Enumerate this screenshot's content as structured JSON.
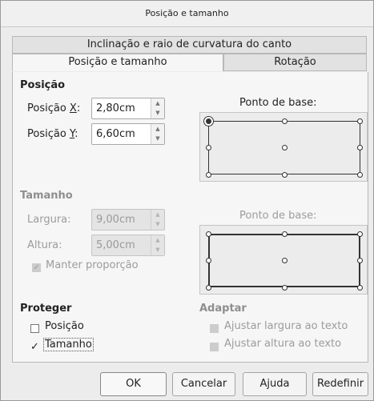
{
  "window": {
    "title": "Posição e tamanho"
  },
  "tabs": {
    "row1": {
      "slant": "Inclinação e raio de curvatura do canto"
    },
    "row2": {
      "position_size": "Posição e tamanho",
      "rotation": "Rotação"
    }
  },
  "position": {
    "header": "Posição",
    "x_label": "Posição X:",
    "x_mnemonic": "X",
    "x_value": "2,80cm",
    "y_label": "Posição Y:",
    "y_mnemonic": "Y",
    "y_value": "6,60cm",
    "base_point_label": "Ponto de base:"
  },
  "size": {
    "header": "Tamanho",
    "width_label": "Largura:",
    "width_value": "9,00cm",
    "height_label": "Altura:",
    "height_value": "5,00cm",
    "keep_ratio_label": "Manter proporção",
    "base_point_label": "Ponto de base:"
  },
  "protect": {
    "header": "Proteger",
    "position_label": "Posição",
    "position_checked": false,
    "size_label": "Tamanho",
    "size_checked": true
  },
  "adapt": {
    "header": "Adaptar",
    "fit_width_label": "Ajustar largura ao texto",
    "fit_height_label": "Ajustar altura ao texto"
  },
  "buttons": {
    "ok": "OK",
    "cancel": "Cancelar",
    "help": "Ajuda",
    "reset": "Redefinir"
  },
  "icons": {
    "spin_up": "▲",
    "spin_down": "▼",
    "check": "✓"
  },
  "colors": {
    "dialog_bg": "#ececec",
    "panel_bg": "#f6f6f6",
    "disabled_text": "#9c9c9c"
  }
}
